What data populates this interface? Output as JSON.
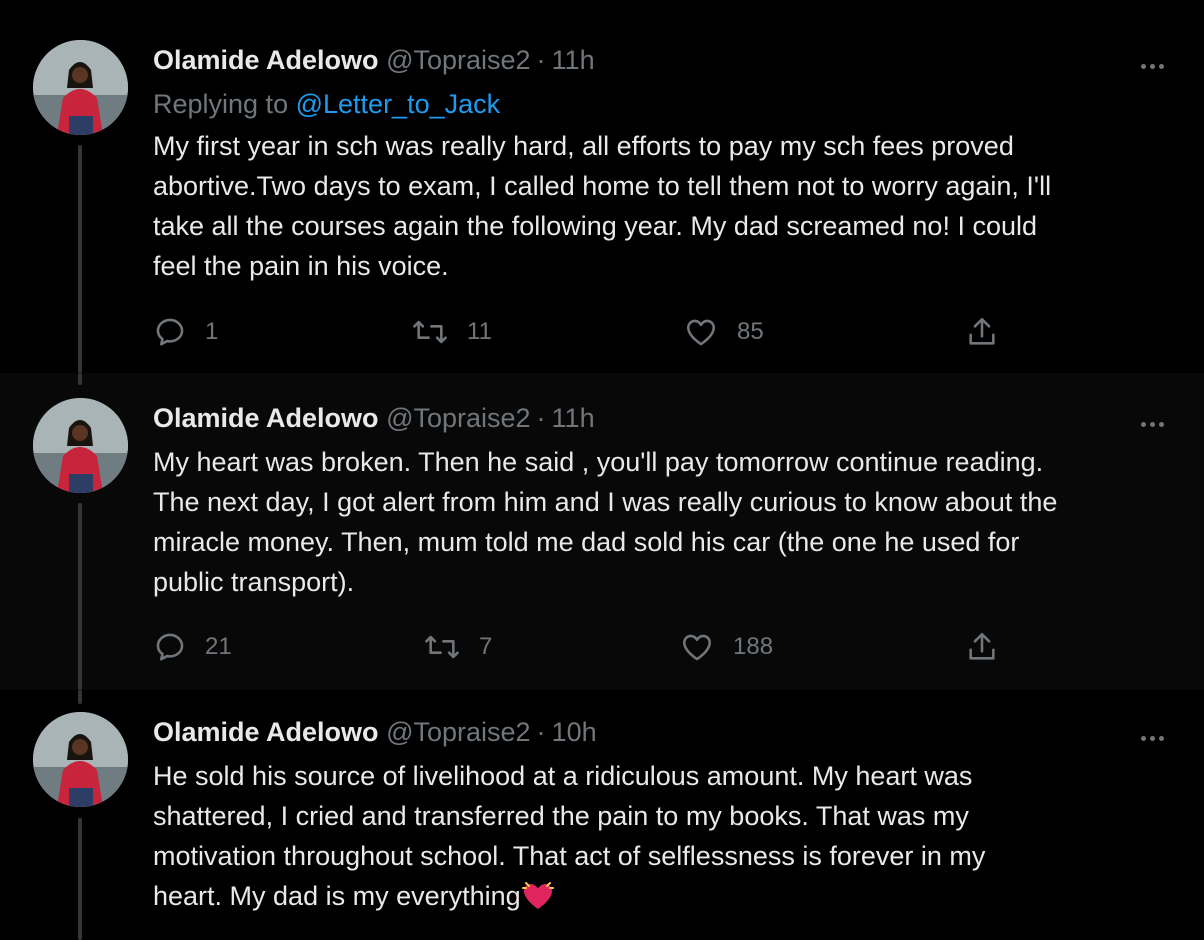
{
  "tweets": [
    {
      "display_name": "Olamide Adelowo",
      "handle": "@Topraise2",
      "separator": "·",
      "time": "11h",
      "replying_prefix": "Replying to",
      "replying_to": "@Letter_to_Jack",
      "text_lines": [
        "My first year in sch was really hard, all efforts to pay my sch fees proved",
        "abortive.Two days to exam, I called home to tell them not to worry again, I'll",
        "take all the courses again the following year. My dad screamed no! I could",
        "feel the pain in his voice."
      ],
      "counts": {
        "replies": "1",
        "retweets": "11",
        "likes": "85"
      }
    },
    {
      "display_name": "Olamide Adelowo",
      "handle": "@Topraise2",
      "separator": "·",
      "time": "11h",
      "text_lines": [
        "My heart was broken. Then he said , you'll pay tomorrow continue reading.",
        "The next day, I got alert from him and I was really curious to know about the",
        "miracle money. Then, mum told me dad sold his car (the one he used for",
        "public transport)."
      ],
      "counts": {
        "replies": "21",
        "retweets": "7",
        "likes": "188"
      }
    },
    {
      "display_name": "Olamide Adelowo",
      "handle": "@Topraise2",
      "separator": "·",
      "time": "10h",
      "text_lines": [
        "He sold his source of livelihood at a ridiculous amount. My heart was",
        "shattered, I cried and transferred the pain to my books. That was my",
        "motivation throughout school. That act of selflessness is forever in my",
        "heart. My dad is my everything"
      ],
      "trailing_emoji": "beating-heart-emoji"
    }
  ],
  "icons": {
    "reply": "reply-icon",
    "retweet": "retweet-icon",
    "like": "heart-icon",
    "share": "share-icon",
    "more": "more-icon"
  },
  "colors": {
    "background": "#000000",
    "text": "#e7e9ea",
    "secondary": "#71767b",
    "accent": "#1d9bf0",
    "heart_emoji": "#e0245e"
  }
}
